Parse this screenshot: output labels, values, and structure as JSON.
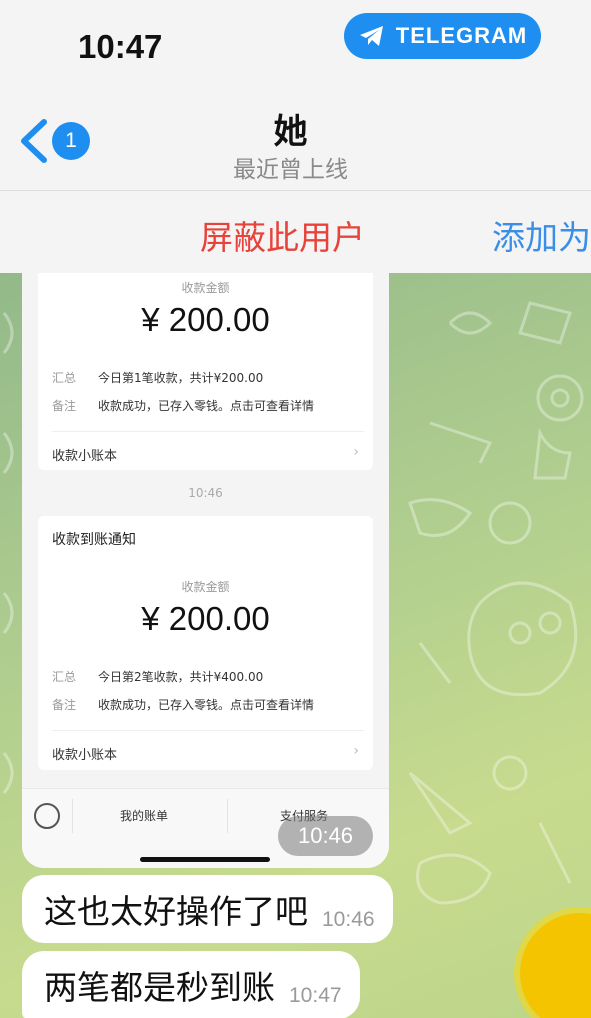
{
  "status_bar": {
    "time": "10:47",
    "app_badge": "TELEGRAM"
  },
  "nav": {
    "back_count": "1",
    "title": "她",
    "subtitle": "最近曾上线"
  },
  "actions": {
    "block": "屏蔽此用户",
    "add": "添加为"
  },
  "receipt": {
    "card1": {
      "amount_label": "收款金额",
      "amount": "¥ 200.00",
      "summary_label": "汇总",
      "summary_value": "今日第1笔收款，共计¥200.00",
      "note_label": "备注",
      "note_value": "收款成功，已存入零钱。点击可查看详情",
      "link": "收款小账本"
    },
    "middle_time": "10:46",
    "card2": {
      "title": "收款到账通知",
      "amount_label": "收款金额",
      "amount": "¥ 200.00",
      "summary_label": "汇总",
      "summary_value": "今日第2笔收款，共计¥400.00",
      "note_label": "备注",
      "note_value": "收款成功，已存入零钱。点击可查看详情",
      "link": "收款小账本"
    },
    "bottom_bar": {
      "item1": "我的账单",
      "item2": "支付服务"
    },
    "image_time": "10:46"
  },
  "messages": [
    {
      "text": "这也太好操作了吧",
      "time": "10:46"
    },
    {
      "text": "两笔都是秒到账",
      "time": "10:47"
    }
  ],
  "colors": {
    "accent": "#1f8ef1",
    "danger": "#e8433b",
    "link": "#3a8ee6"
  }
}
